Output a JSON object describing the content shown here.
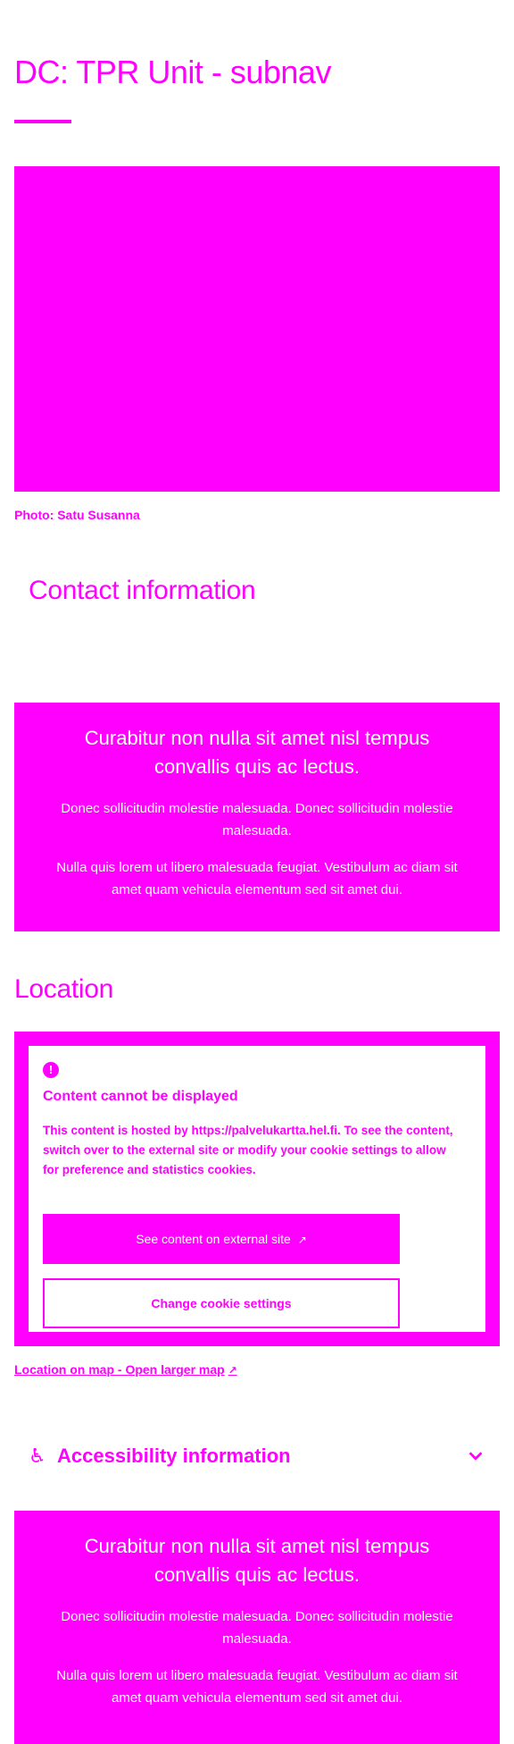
{
  "page": {
    "title": "DC: TPR Unit - subnav",
    "photo_credit": "Photo: Satu Susanna"
  },
  "contact": {
    "heading": "Contact information"
  },
  "info_box_1": {
    "lead": "Curabitur non nulla sit amet nisl tempus convallis quis ac lectus.",
    "para1": "Donec sollicitudin molestie malesuada. Donec sollicitudin molestie malesuada.",
    "para2": "Nulla quis lorem ut libero malesuada feugiat. Vestibulum ac diam sit amet quam vehicula elementum sed sit amet dui."
  },
  "location": {
    "heading": "Location",
    "alert_icon": "exclamation-icon",
    "alert_title": "Content cannot be displayed",
    "alert_text": "This content is hosted by https://palvelukartta.hel.fi. To see the content, switch over to the external site or modify your cookie settings to allow for preference and statistics cookies.",
    "external_button": "See content on external site",
    "cookie_button": "Change cookie settings",
    "map_link": "Location on map - Open larger map"
  },
  "accessibility": {
    "title": "Accessibility information",
    "icon": "wheelchair-icon",
    "chevron": "chevron-down-icon"
  },
  "info_box_2": {
    "lead": "Curabitur non nulla sit amet nisl tempus convallis quis ac lectus.",
    "para1": "Donec sollicitudin molestie malesuada. Donec sollicitudin molestie malesuada.",
    "para2": "Nulla quis lorem ut libero malesuada feugiat. Vestibulum ac diam sit amet quam vehicula elementum sed sit amet dui."
  },
  "colors": {
    "accent": "#ff00ff",
    "background": "#ffffff"
  }
}
